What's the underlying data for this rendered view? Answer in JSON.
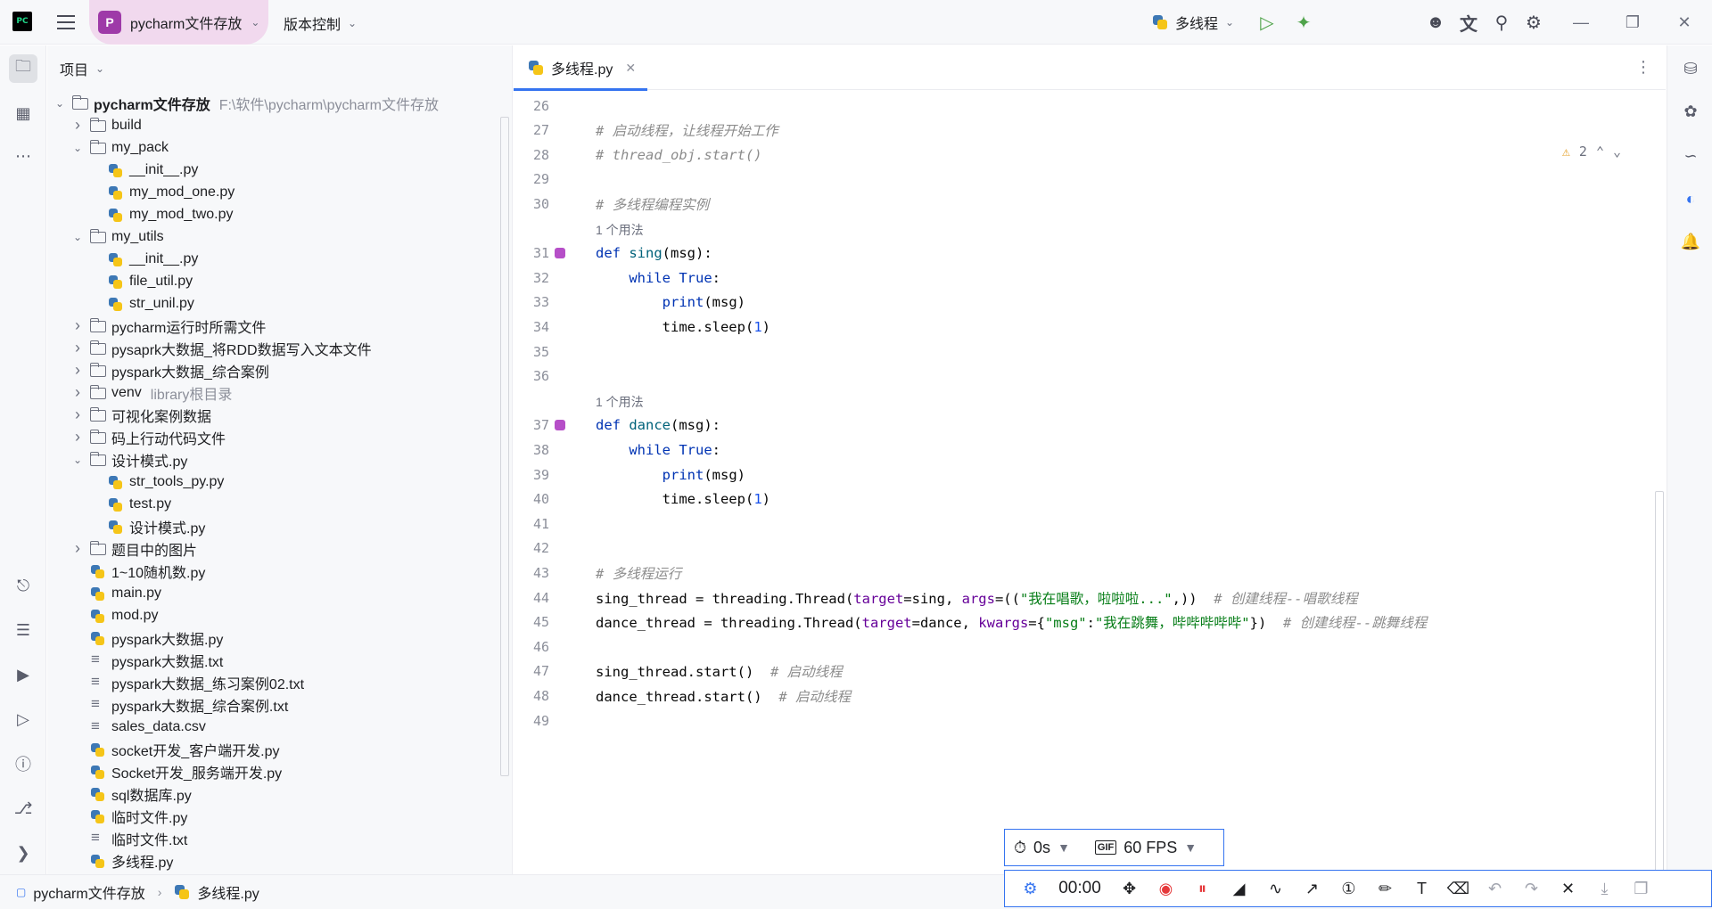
{
  "titlebar": {
    "logo_text": "PC",
    "project_badge": "P",
    "project_name": "pycharm文件存放",
    "vcs_label": "版本控制",
    "run_config": "多线程"
  },
  "project_panel": {
    "header": "项目",
    "tree": [
      {
        "name": "pycharm文件存放",
        "hint": "F:\\软件\\pycharm\\pycharm文件存放",
        "type": "folder",
        "depth": 0,
        "expanded": true,
        "bold": true
      },
      {
        "name": "build",
        "type": "folder",
        "depth": 1,
        "expanded": false
      },
      {
        "name": "my_pack",
        "type": "folder",
        "depth": 1,
        "expanded": true
      },
      {
        "name": "__init__.py",
        "type": "py",
        "depth": 2
      },
      {
        "name": "my_mod_one.py",
        "type": "py",
        "depth": 2
      },
      {
        "name": "my_mod_two.py",
        "type": "py",
        "depth": 2
      },
      {
        "name": "my_utils",
        "type": "folder",
        "depth": 1,
        "expanded": true
      },
      {
        "name": "__init__.py",
        "type": "py",
        "depth": 2
      },
      {
        "name": "file_util.py",
        "type": "py",
        "depth": 2
      },
      {
        "name": "str_unil.py",
        "type": "py",
        "depth": 2
      },
      {
        "name": "pycharm运行时所需文件",
        "type": "folder",
        "depth": 1,
        "expanded": false
      },
      {
        "name": "pysaprk大数据_将RDD数据写入文本文件",
        "type": "folder",
        "depth": 1,
        "expanded": false
      },
      {
        "name": "pyspark大数据_综合案例",
        "type": "folder",
        "depth": 1,
        "expanded": false
      },
      {
        "name": "venv",
        "hint": "library根目录",
        "type": "folder",
        "depth": 1,
        "expanded": false
      },
      {
        "name": "可视化案例数据",
        "type": "folder",
        "depth": 1,
        "expanded": false
      },
      {
        "name": "码上行动代码文件",
        "type": "folder",
        "depth": 1,
        "expanded": false
      },
      {
        "name": "设计模式.py",
        "type": "folder",
        "depth": 1,
        "expanded": true
      },
      {
        "name": "str_tools_py.py",
        "type": "py",
        "depth": 2
      },
      {
        "name": "test.py",
        "type": "py",
        "depth": 2
      },
      {
        "name": "设计模式.py",
        "type": "py",
        "depth": 2
      },
      {
        "name": "题目中的图片",
        "type": "folder",
        "depth": 1,
        "expanded": false
      },
      {
        "name": "1~10随机数.py",
        "type": "py",
        "depth": 1
      },
      {
        "name": "main.py",
        "type": "py",
        "depth": 1
      },
      {
        "name": "mod.py",
        "type": "py",
        "depth": 1
      },
      {
        "name": "pyspark大数据.py",
        "type": "py",
        "depth": 1
      },
      {
        "name": "pyspark大数据.txt",
        "type": "txt",
        "depth": 1
      },
      {
        "name": "pyspark大数据_练习案例02.txt",
        "type": "txt",
        "depth": 1
      },
      {
        "name": "pyspark大数据_综合案例.txt",
        "type": "txt",
        "depth": 1
      },
      {
        "name": "sales_data.csv",
        "type": "txt",
        "depth": 1
      },
      {
        "name": "socket开发_客户端开发.py",
        "type": "py",
        "depth": 1
      },
      {
        "name": "Socket开发_服务端开发.py",
        "type": "py",
        "depth": 1
      },
      {
        "name": "sql数据库.py",
        "type": "py",
        "depth": 1
      },
      {
        "name": "临时文件.py",
        "type": "py",
        "depth": 1
      },
      {
        "name": "临时文件.txt",
        "type": "txt",
        "depth": 1
      },
      {
        "name": "多线程.py",
        "type": "py",
        "depth": 1
      }
    ]
  },
  "editor": {
    "tab_label": "多线程.py",
    "warning_count": "2",
    "usage_hint": "1 个用法",
    "lines": [
      {
        "n": "26",
        "tokens": []
      },
      {
        "n": "27",
        "tokens": [
          [
            "cmt",
            "# 启动线程，让线程开始工作"
          ]
        ]
      },
      {
        "n": "28",
        "tokens": [
          [
            "cmt",
            "# thread_obj.start()"
          ]
        ]
      },
      {
        "n": "29",
        "tokens": []
      },
      {
        "n": "30",
        "tokens": [
          [
            "cmt",
            "# 多线程编程实例"
          ]
        ]
      },
      {
        "usage": true
      },
      {
        "n": "31",
        "mark": true,
        "tokens": [
          [
            "kw",
            "def "
          ],
          [
            "fn",
            "sing"
          ],
          [
            "",
            "(msg):"
          ]
        ]
      },
      {
        "n": "32",
        "tokens": [
          [
            "",
            "    "
          ],
          [
            "kw",
            "while True"
          ],
          [
            "",
            ":"
          ]
        ]
      },
      {
        "n": "33",
        "tokens": [
          [
            "",
            "        "
          ],
          [
            "kw",
            "print"
          ],
          [
            "",
            "(msg)"
          ]
        ]
      },
      {
        "n": "34",
        "tokens": [
          [
            "",
            "        time.sleep("
          ],
          [
            "num",
            "1"
          ],
          [
            "",
            ")"
          ]
        ]
      },
      {
        "n": "35",
        "tokens": []
      },
      {
        "n": "36",
        "tokens": []
      },
      {
        "usage": true
      },
      {
        "n": "37",
        "mark": true,
        "tokens": [
          [
            "kw",
            "def "
          ],
          [
            "fn",
            "dance"
          ],
          [
            "",
            "(msg):"
          ]
        ]
      },
      {
        "n": "38",
        "tokens": [
          [
            "",
            "    "
          ],
          [
            "kw",
            "while True"
          ],
          [
            "",
            ":"
          ]
        ]
      },
      {
        "n": "39",
        "tokens": [
          [
            "",
            "        "
          ],
          [
            "kw",
            "print"
          ],
          [
            "",
            "(msg)"
          ]
        ]
      },
      {
        "n": "40",
        "tokens": [
          [
            "",
            "        time.sleep("
          ],
          [
            "num",
            "1"
          ],
          [
            "",
            ")"
          ]
        ]
      },
      {
        "n": "41",
        "tokens": []
      },
      {
        "n": "42",
        "tokens": []
      },
      {
        "n": "43",
        "tokens": [
          [
            "cmt",
            "# 多线程运行"
          ]
        ]
      },
      {
        "n": "44",
        "tokens": [
          [
            "",
            "sing_thread = threading.Thread("
          ],
          [
            "param",
            "target"
          ],
          [
            "",
            "=sing, "
          ],
          [
            "param",
            "args"
          ],
          [
            "",
            "=(("
          ],
          [
            "str",
            "\"我在唱歌，啦啦啦...\""
          ],
          [
            "",
            ",))  "
          ],
          [
            "cmt",
            "# 创建线程--唱歌线程"
          ]
        ]
      },
      {
        "n": "45",
        "tokens": [
          [
            "",
            "dance_thread = threading.Thread("
          ],
          [
            "param",
            "target"
          ],
          [
            "",
            "=dance, "
          ],
          [
            "param",
            "kwargs"
          ],
          [
            "",
            "={"
          ],
          [
            "str",
            "\"msg\""
          ],
          [
            "",
            ":"
          ],
          [
            "str",
            "\"我在跳舞，哔哔哔哔哔\""
          ],
          [
            "",
            "})  "
          ],
          [
            "cmt",
            "# 创建线程--跳舞线程"
          ]
        ]
      },
      {
        "n": "46",
        "tokens": []
      },
      {
        "n": "47",
        "tokens": [
          [
            "",
            "sing_thread.start()  "
          ],
          [
            "cmt",
            "# 启动线程"
          ]
        ]
      },
      {
        "n": "48",
        "tokens": [
          [
            "",
            "dance_thread.start()  "
          ],
          [
            "cmt",
            "# 启动线程"
          ]
        ]
      },
      {
        "n": "49",
        "tokens": []
      }
    ]
  },
  "statusbar": {
    "crumb_project": "pycharm文件存放",
    "crumb_file": "多线程.py"
  },
  "recorder": {
    "delay": "0s",
    "gif_tag": "GIF",
    "fps": "60 FPS",
    "time": "00:00"
  },
  "colors": {
    "accent": "#3574f0",
    "project_badge": "#9e3aa8",
    "record_red": "#e5393b"
  }
}
